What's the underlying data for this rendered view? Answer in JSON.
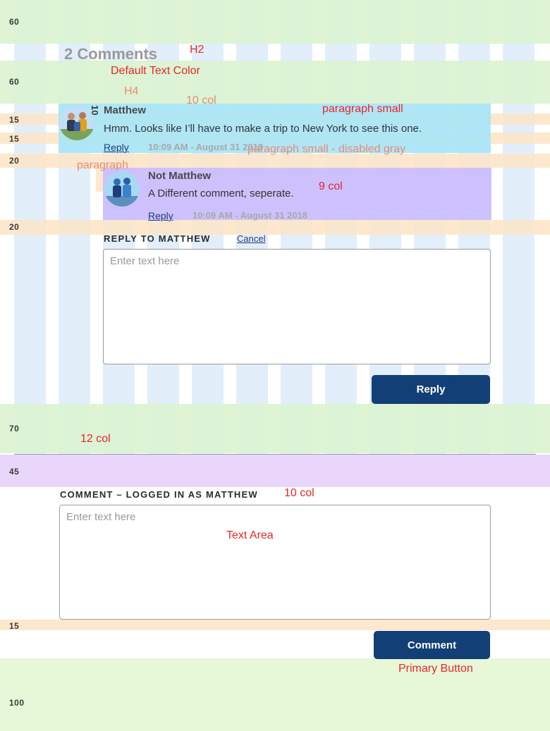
{
  "section_title": "2 Comments",
  "comments": [
    {
      "author": "Matthew",
      "text": "Hmm. Looks like I’ll have to make a trip to New York to see this one.",
      "reply_label": "Reply",
      "timestamp": "10:09 AM - August 31 2018"
    },
    {
      "author": "Not Matthew",
      "text": "A Different comment, seperate.",
      "reply_label": "Reply",
      "timestamp": "10:09 AM - August 31 2018"
    }
  ],
  "reply_form": {
    "heading": "REPLY TO MATTHEW",
    "cancel_label": "Cancel",
    "placeholder": "Enter text here",
    "submit_label": "Reply"
  },
  "comment_form": {
    "heading": "COMMENT – LOGGED IN AS MATTHEW",
    "placeholder": "Enter text here",
    "submit_label": "Comment"
  },
  "spacing_labels": {
    "s1": "60",
    "s2": "60",
    "s3": "15",
    "s4": "15",
    "s5": "20",
    "s6": "20",
    "s7": "70",
    "s8": "45",
    "s9": "15",
    "s10": "100",
    "vertical": "10"
  },
  "annotations": {
    "h2": "H2",
    "default_text_color": "Default Text Color",
    "h4": "H4",
    "ten_col_top": "10 col",
    "paragraph_small": "paragraph small",
    "paragraph_small_disabled": "paragraph small - disabled gray",
    "paragraph": "paragraph",
    "nine_col": "9 col",
    "twelve_col": "12 col",
    "ten_col_form": "10 col",
    "text_area": "Text Area",
    "primary_button": "Primary Button"
  },
  "colors": {
    "primary_button": "#123f76",
    "annotation_red": "#e8262a",
    "annotation_salmon": "#ea8b72",
    "link": "#1c3e7a",
    "disabled_gray": "#a8a8a8",
    "heading_gray": "#9a9a9a"
  }
}
